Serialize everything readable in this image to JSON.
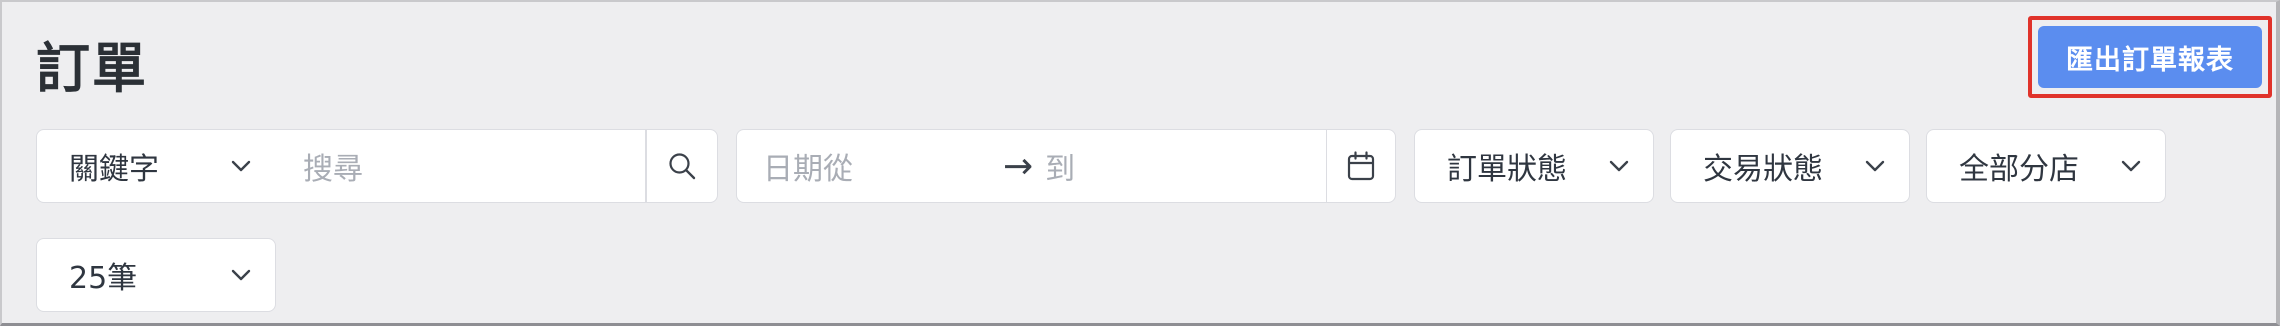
{
  "page": {
    "title": "訂單",
    "export_label": "匯出訂單報表"
  },
  "filters": {
    "keyword_select": "關鍵字",
    "search_placeholder": "搜尋",
    "date_from_placeholder": "日期從",
    "date_arrow": "→",
    "date_to_placeholder": "到",
    "order_status": "訂單狀態",
    "transaction_status": "交易狀態",
    "branch": "全部分店",
    "page_size": "25筆"
  },
  "colors": {
    "accent": "#5b8def",
    "highlight_border": "#e0332b",
    "background": "#eeeef0"
  },
  "icons": {
    "search": "search-icon",
    "calendar": "calendar-icon",
    "chevron": "chevron-down-icon"
  }
}
